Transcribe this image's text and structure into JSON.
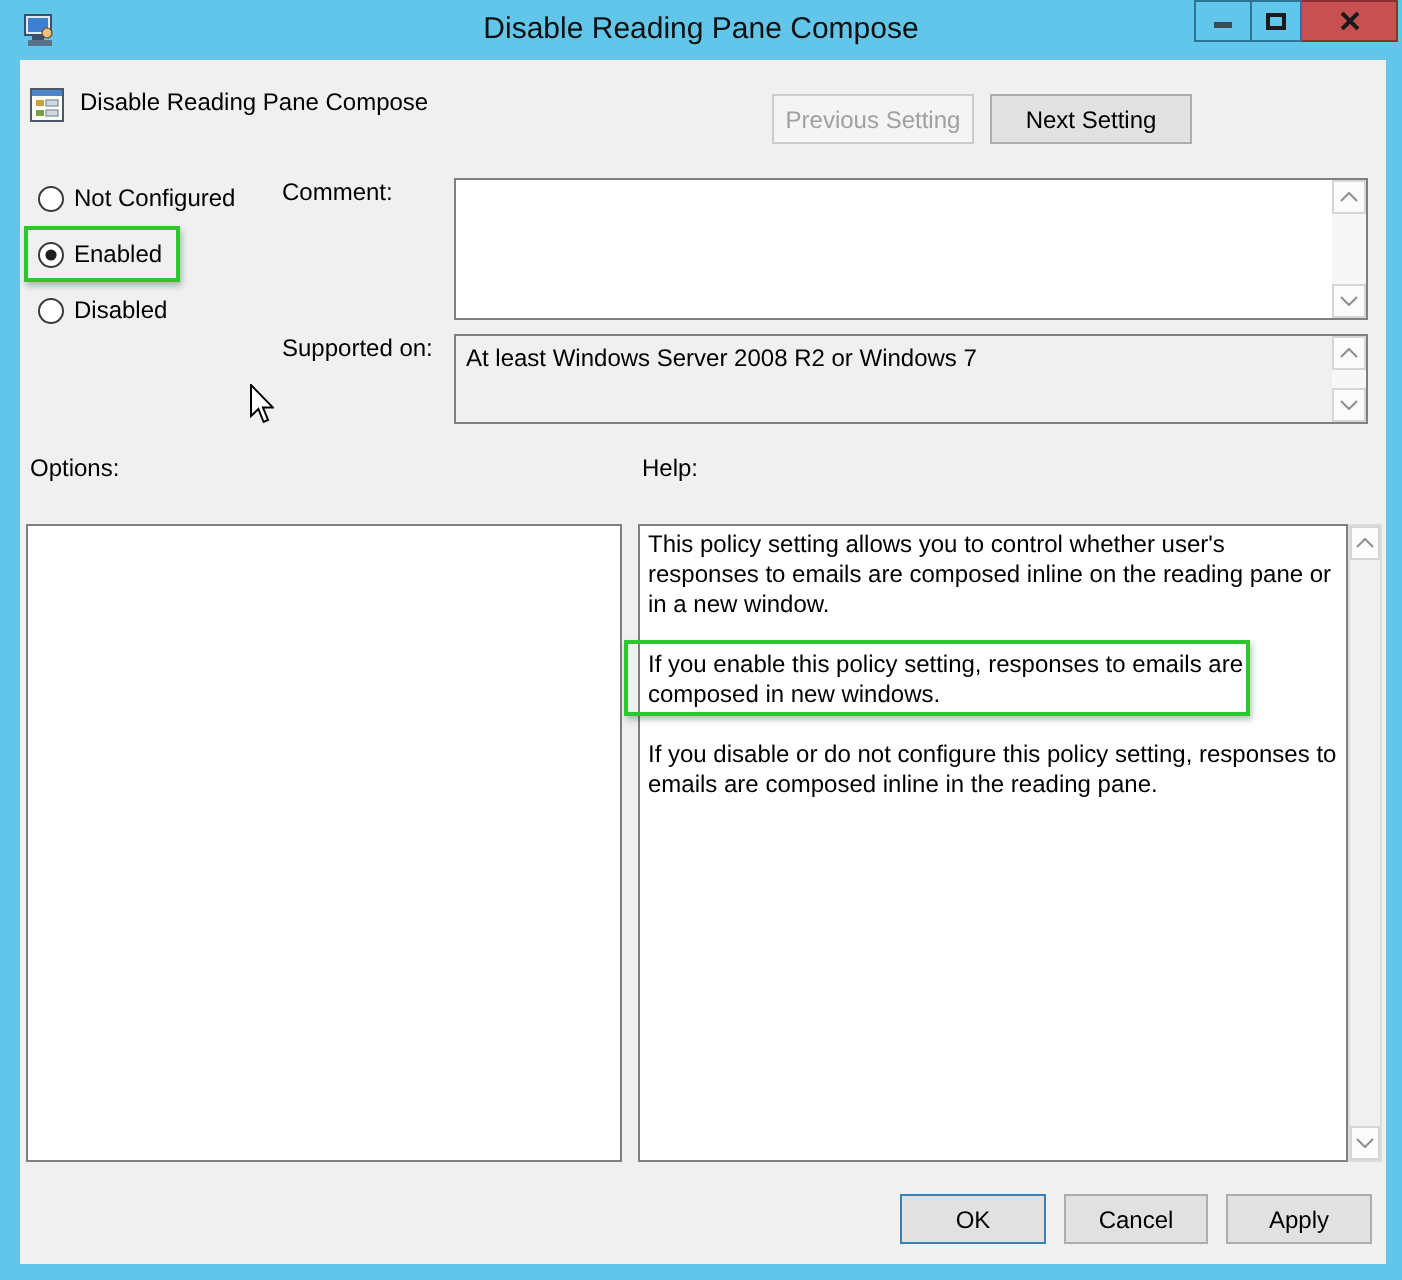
{
  "window": {
    "title": "Disable Reading Pane Compose"
  },
  "header": {
    "setting_name": "Disable Reading Pane Compose",
    "buttons": [
      {
        "label": "Previous Setting",
        "disabled": true
      },
      {
        "label": "Next Setting",
        "disabled": false
      }
    ]
  },
  "state_options": [
    {
      "label": "Not Configured",
      "selected": false,
      "highlighted": false
    },
    {
      "label": "Enabled",
      "selected": true,
      "highlighted": true
    },
    {
      "label": "Disabled",
      "selected": false,
      "highlighted": false
    }
  ],
  "comment": {
    "label": "Comment:"
  },
  "supported_on": {
    "label": "Supported on:",
    "value": "At least Windows Server 2008 R2 or Windows 7"
  },
  "options": {
    "label": "Options:"
  },
  "help": {
    "label": "Help:",
    "paragraphs": [
      {
        "text": "This policy setting allows you to control whether user's responses to emails are composed inline on the reading pane or in a new window.",
        "highlighted": false
      },
      {
        "text": "If you enable this policy setting, responses to emails are composed in new windows.",
        "highlighted": true
      },
      {
        "text": "If you disable or do not configure this policy setting, responses to emails are composed inline in the reading pane.",
        "highlighted": false
      }
    ]
  },
  "buttons": [
    {
      "label": "OK",
      "default": true
    },
    {
      "label": "Cancel",
      "default": false
    },
    {
      "label": "Apply",
      "default": false
    }
  ]
}
